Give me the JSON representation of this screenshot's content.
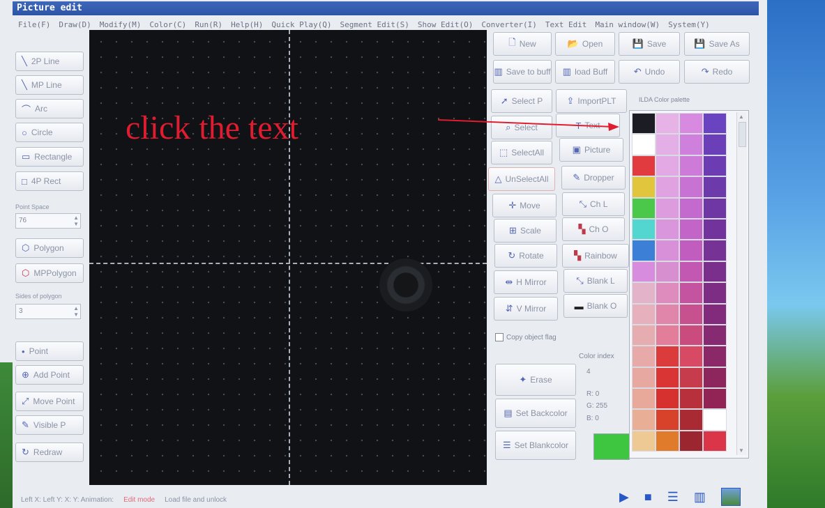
{
  "window": {
    "title": "Picture edit",
    "menu": [
      "File(F)",
      "Draw(D)",
      "Modify(M)",
      "Color(C)",
      "Run(R)",
      "Help(H)",
      "Quick Play(Q)",
      "Segment Edit(S)",
      "Show Edit(O)",
      "Converter(I)",
      "Text Edit",
      "Main window(W)",
      "System(Y)"
    ]
  },
  "left_tools": {
    "line2p": "2P Line",
    "mpline": "MP Line",
    "arc": "Arc",
    "circle": "Circle",
    "rectangle": "Rectangle",
    "rect4p": "4P Rect",
    "point_space_label": "Point Space",
    "point_space_value": "76",
    "polygon": "Polygon",
    "mppolygon": "MPPolygon",
    "sides_label": "Sides of polygon",
    "sides_value": "3",
    "point": "Point",
    "add_point": "Add Point",
    "move_point": "Move Point",
    "visible_point": "Visible P",
    "redraw": "Redraw"
  },
  "annotation": {
    "text": "click the text"
  },
  "top_buttons": {
    "new": "New",
    "open": "Open",
    "save": "Save",
    "save_as": "Save As",
    "save_to_buff": "Save to buff",
    "load_buff": "load Buff",
    "undo": "Undo",
    "redo": "Redo"
  },
  "tool_buttons": {
    "select_p": "Select P",
    "import_plt": "ImportPLT",
    "select": "Select",
    "text": "Text",
    "select_all": "SelectAll",
    "picture": "Picture",
    "unselect_all": "UnSelectAll",
    "dropper": "Dropper",
    "move": "Move",
    "ch_l": "Ch L",
    "scale": "Scale",
    "ch_o": "Ch O",
    "rotate": "Rotate",
    "rainbow": "Rainbow",
    "h_mirror": "H Mirror",
    "blank_l": "Blank L",
    "v_mirror": "V Mirror",
    "blank_o": "Blank O"
  },
  "copy_object": "Copy object flag",
  "erase": "Erase",
  "set_backcolor_1": "Set Backcolor",
  "set_backcolor_2": "Set Blankcolor",
  "color_index": {
    "label": "Color index",
    "index": "4",
    "r": "R: 0",
    "g": "G: 255",
    "b": "B: 0",
    "current_color": "#3ec640"
  },
  "palette": {
    "title": "ILDA Color palette",
    "colors": [
      "#1c1c24",
      "#e7b3e6",
      "#d78ae0",
      "#6a43c0",
      "#ffffff",
      "#e4aee6",
      "#cf7fdc",
      "#6a3fb8",
      "#e23b3f",
      "#e3a9e4",
      "#cd7ad8",
      "#6b3cb2",
      "#e1c63d",
      "#e0a2e1",
      "#c872d4",
      "#6d3aac",
      "#4bc84a",
      "#dd9cde",
      "#c46acf",
      "#6f37a4",
      "#52d6cf",
      "#da96dc",
      "#c264c8",
      "#72349c",
      "#3b7fd7",
      "#d891d8",
      "#c05dbf",
      "#763294",
      "#d78cde",
      "#d88fcf",
      "#c258b2",
      "#7a2f8c",
      "#e3b4c9",
      "#dd8cbd",
      "#c4549f",
      "#7e2d84",
      "#e6b0bc",
      "#e086ab",
      "#c7508e",
      "#822b7c",
      "#e6adb1",
      "#e37e9a",
      "#ca4c7e",
      "#862a72",
      "#e7aaa8",
      "#dc3b3b",
      "#d84a63",
      "#8a2868",
      "#e7a8a1",
      "#d93535",
      "#c73c4c",
      "#8e265e",
      "#e8a99b",
      "#d6312f",
      "#b8303b",
      "#912455",
      "#e9ae96",
      "#d9422a",
      "#a92a33",
      "#ffffff",
      "#eec994",
      "#df7b2a",
      "#9c2630",
      "#da3548"
    ]
  },
  "status": {
    "left": "Left X:  Left Y:  X:  Y:  Animation:",
    "mode": "Edit mode",
    "info": "Load file and unlock"
  }
}
